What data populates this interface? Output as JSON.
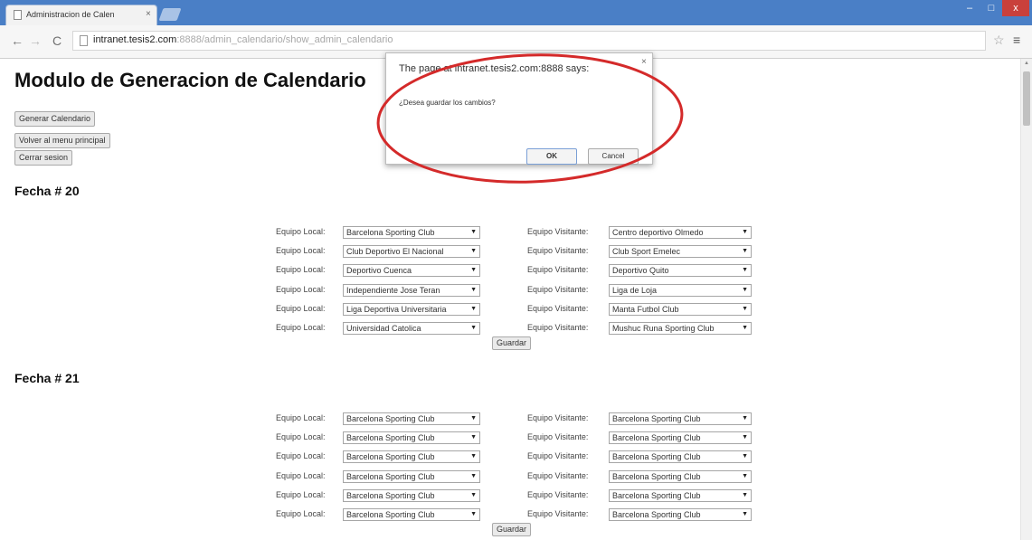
{
  "browser": {
    "tab_title": "Administracion de Calen",
    "tab_close": "×",
    "url_host": "intranet.tesis2.com",
    "url_path": ":8888/admin_calendario/show_admin_calendario",
    "window_min": "–",
    "window_max": "□",
    "window_close": "x"
  },
  "page": {
    "title": "Modulo de Generacion de Calendario",
    "buttons": {
      "generar": "Generar Calendario",
      "volver": "Volver al menu principal",
      "cerrar": "Cerrar sesion"
    },
    "local_label": "Equipo Local:",
    "visitante_label": "Equipo Visitante:",
    "guardar_label": "Guardar",
    "fechas": [
      {
        "title": "Fecha # 20",
        "matches": [
          {
            "local": "Barcelona Sporting Club",
            "visitante": "Centro deportivo Olmedo"
          },
          {
            "local": "Club Deportivo El Nacional",
            "visitante": "Club Sport Emelec"
          },
          {
            "local": "Deportivo Cuenca",
            "visitante": "Deportivo Quito"
          },
          {
            "local": "Independiente Jose Teran",
            "visitante": "Liga de Loja"
          },
          {
            "local": "Liga Deportiva Universitaria",
            "visitante": "Manta Futbol Club"
          },
          {
            "local": "Universidad Catolica",
            "visitante": "Mushuc Runa Sporting Club"
          }
        ]
      },
      {
        "title": "Fecha # 21",
        "matches": [
          {
            "local": "Barcelona Sporting Club",
            "visitante": "Barcelona Sporting Club"
          },
          {
            "local": "Barcelona Sporting Club",
            "visitante": "Barcelona Sporting Club"
          },
          {
            "local": "Barcelona Sporting Club",
            "visitante": "Barcelona Sporting Club"
          },
          {
            "local": "Barcelona Sporting Club",
            "visitante": "Barcelona Sporting Club"
          },
          {
            "local": "Barcelona Sporting Club",
            "visitante": "Barcelona Sporting Club"
          },
          {
            "local": "Barcelona Sporting Club",
            "visitante": "Barcelona Sporting Club"
          }
        ]
      }
    ]
  },
  "dialog": {
    "title": "The page at intranet.tesis2.com:8888 says:",
    "message": "¿Desea guardar los cambios?",
    "ok_label": "OK",
    "cancel_label": "Cancel",
    "close_label": "×"
  },
  "colors": {
    "titlebar": "#4a7fc6",
    "highlight_ring": "#d42a2a"
  },
  "icons": {
    "back": "back-arrow-icon",
    "forward": "forward-arrow-icon",
    "reload": "reload-icon",
    "bookmark": "star-icon",
    "menu": "hamburger-menu-icon",
    "dropdown": "chevron-down-icon"
  }
}
